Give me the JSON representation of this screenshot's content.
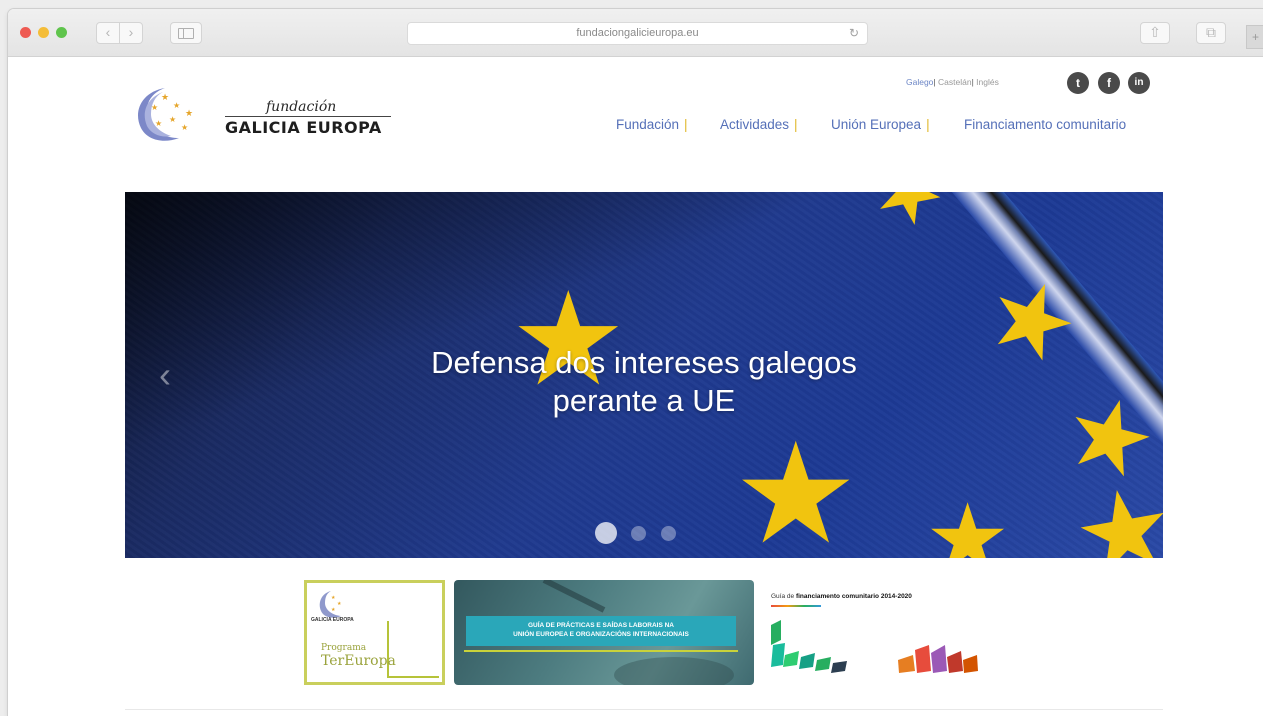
{
  "browser": {
    "url": "fundaciongalicieuropa.eu",
    "back_glyph": "‹",
    "forward_glyph": "›",
    "reload_glyph": "↻",
    "share_glyph": "⇧",
    "tabs_glyph": "⧉",
    "new_tab_glyph": "+"
  },
  "logo": {
    "top_word": "fundación",
    "name": "GALICIA EUROPA"
  },
  "languages": {
    "items": [
      "Galego",
      "Castelán",
      "Inglés"
    ],
    "active": "Galego",
    "separator": "|"
  },
  "social": {
    "twitter_glyph": "t",
    "facebook_glyph": "f",
    "linkedin_glyph": "in"
  },
  "nav": {
    "items": [
      "Fundación",
      "Actividades",
      "Unión Europea",
      "Financiamento comunitario"
    ],
    "separator": "|"
  },
  "hero": {
    "title_line1": "Defensa dos intereses galegos",
    "title_line2": "perante a UE",
    "prev_glyph": "‹",
    "slides": 3,
    "active_slide": 1
  },
  "banners": {
    "tereuropa": {
      "org": "GALICIA EUROPA",
      "program_prefix": "Programa",
      "program_name": "TerEuropa"
    },
    "guide": {
      "line1": "GUÍA DE PRÁCTICAS E SAÍDAS LABORAIS NA",
      "line2": "UNIÓN EUROPEA E ORGANIZACIÓNS INTERNACIONAIS"
    },
    "financing": {
      "prefix": "Guía de",
      "title": "financiamento comunitario 2014-2020"
    }
  },
  "colors": {
    "nav_link": "#5570b8",
    "nav_separator": "#e0b92c",
    "flag_blue": "#203a8e",
    "flag_star": "#f1c40f",
    "tereuropa_green": "#b6c339",
    "guide_teal": "#2aa7b9"
  }
}
